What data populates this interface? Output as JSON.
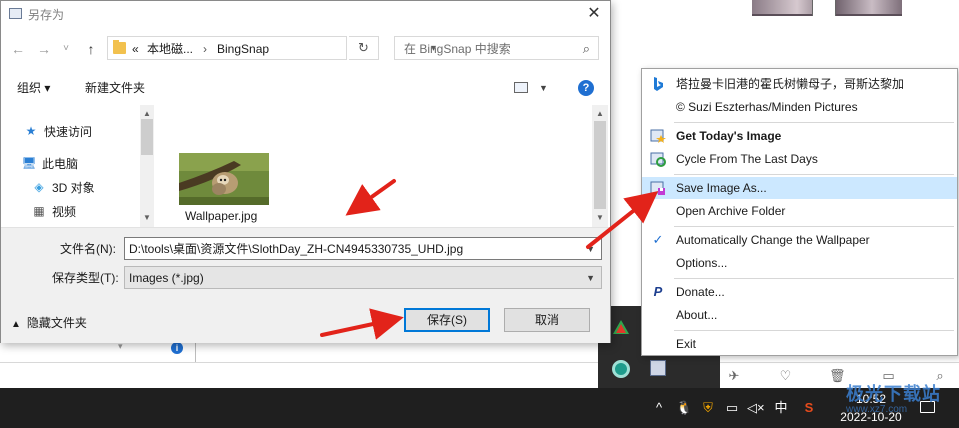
{
  "dialog": {
    "title": "另存为",
    "nav": {
      "back": "←",
      "forward": "→",
      "recent": "˅",
      "up": "↑",
      "path": [
        "«",
        "本地磁...",
        "BingSnap"
      ],
      "path_sep": "›",
      "refresh": "↻",
      "search_placeholder": "在 BingSnap 中搜索"
    },
    "toolbar": {
      "organize": "组织 ▾",
      "new_folder": "新建文件夹",
      "help": "?"
    },
    "nav_pane": [
      {
        "label": "快速访问",
        "icon": "star-pin-icon"
      },
      {
        "label": "此电脑",
        "icon": "computer-icon"
      },
      {
        "label": "3D 对象",
        "icon": "cube-icon"
      },
      {
        "label": "视频",
        "icon": "film-icon"
      }
    ],
    "files": [
      {
        "name": "Wallpaper.jpg",
        "icon": "image-thumbnail"
      }
    ],
    "filename_label": "文件名(N):",
    "filename_value": "D:\\tools\\桌面\\资源文件\\SlothDay_ZH-CN4945330735_UHD.jpg",
    "filetype_label": "保存类型(T):",
    "filetype_value": "Images (*.jpg)",
    "hide_folders": "隐藏文件夹",
    "save_button": "保存(S)",
    "cancel_button": "取消",
    "close": "✕"
  },
  "menu": {
    "items": [
      {
        "label": "塔拉曼卡旧港的霍氏树懒母子，哥斯达黎加",
        "icon": "bing-icon",
        "bold": false
      },
      {
        "label": "© Suzi Eszterhas/Minden Pictures",
        "icon": "",
        "bold": false
      },
      {
        "label": "Get Today's Image",
        "icon": "image-star-icon",
        "bold": true
      },
      {
        "label": "Cycle From The Last Days",
        "icon": "image-cycle-icon",
        "bold": false
      },
      {
        "label": "Save Image As...",
        "icon": "save-image-icon",
        "bold": false
      },
      {
        "label": "Open Archive Folder",
        "icon": "",
        "bold": false
      },
      {
        "label": "Automatically Change the Wallpaper",
        "icon": "check-icon",
        "bold": false
      },
      {
        "label": "Options...",
        "icon": "",
        "bold": false
      },
      {
        "label": "Donate...",
        "icon": "paypal-icon",
        "bold": false
      },
      {
        "label": "About...",
        "icon": "",
        "bold": false
      },
      {
        "label": "Exit",
        "icon": "",
        "bold": false
      }
    ],
    "highlight_index": 4
  },
  "taskbar": {
    "tray": [
      "^",
      "中"
    ],
    "time": "10:52",
    "date": "2022-10-20"
  },
  "watermark": {
    "text": "极光下载站",
    "sub": "www.xz7.com"
  },
  "colors": {
    "menu_highlight": "#cce8ff",
    "arrow_red": "#e2231a",
    "taskbar": "#1f1f1f",
    "accent_blue": "#0078d7"
  }
}
